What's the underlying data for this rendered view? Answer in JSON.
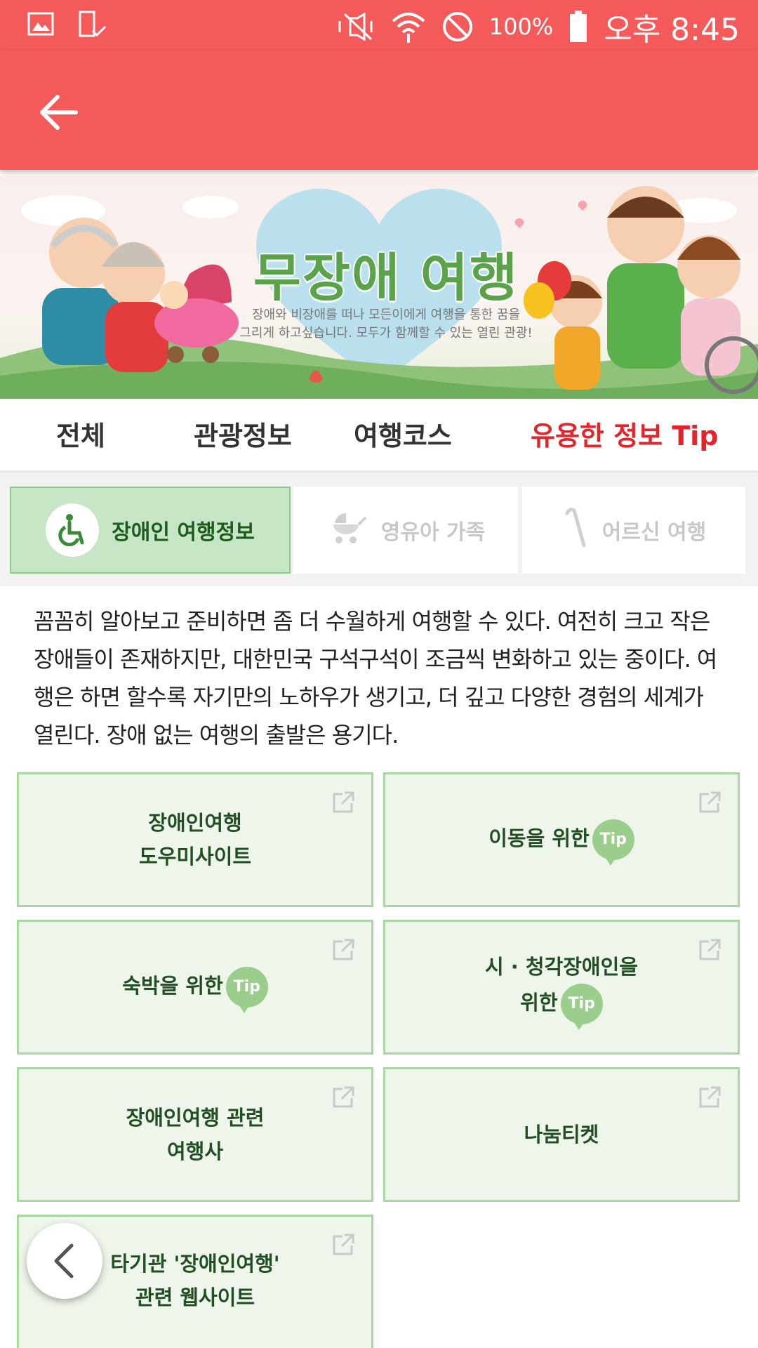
{
  "status_bar": {
    "battery": "100%",
    "time": "오후 8:45",
    "icons": [
      "gallery-icon",
      "device-check-icon",
      "mute-icon",
      "wifi-icon",
      "block-icon",
      "battery-icon"
    ]
  },
  "app_bar": {
    "back_icon": "arrow-left-icon"
  },
  "banner": {
    "title": "무장애 여행",
    "subtitle_line1": "장애와 비장애를 떠나 모든이에게 여행을 통한 꿈을",
    "subtitle_line2": "그리게 하고싶습니다. 모두가 함께할 수 있는 열린 관광!"
  },
  "tabs": [
    {
      "label": "전체"
    },
    {
      "label": "관광정보"
    },
    {
      "label": "여행코스"
    },
    {
      "label": "유용한 정보 Tip",
      "active": true
    }
  ],
  "segments": [
    {
      "label": "장애인 여행정보",
      "icon": "wheelchair-icon",
      "active": true
    },
    {
      "label": "영유아 가족",
      "icon": "stroller-icon"
    },
    {
      "label": "어르신 여행",
      "icon": "cane-icon"
    }
  ],
  "intro_text": "꼼꼼히 알아보고 준비하면 좀 더 수월하게 여행할 수 있다. 여전히 크고 작은 장애들이 존재하지만, 대한민국 구석구석이 조금씩 변화하고 있는 중이다. 여행은 하면 할수록 자기만의 노하우가 생기고, 더 깊고 다양한 경험의 세계가 열린다. 장애 없는 여행의 출발은 용기다.",
  "tip_badge": "Tip",
  "cards": [
    {
      "line1": "장애인여행",
      "line2": "도우미사이트"
    },
    {
      "line1": "이동을 위한",
      "line2": ""
    },
    {
      "line1": "숙박을 위한",
      "line2": ""
    },
    {
      "line1": "시 · 청각장애인을",
      "line2": "위한"
    },
    {
      "line1": "장애인여행 관련",
      "line2": "여행사"
    },
    {
      "line1": "나눔티켓",
      "line2": ""
    },
    {
      "line1": "타기관 '장애인여행'",
      "line2": "관련 웹사이트"
    }
  ],
  "colors": {
    "primary": "#f45a5a",
    "active_tab": "#e3242b",
    "card_bg": "#eef6ec",
    "card_border": "#a9d7a2",
    "segment_active": "#c6e6c6",
    "tip_badge": "#9bcd8d"
  }
}
